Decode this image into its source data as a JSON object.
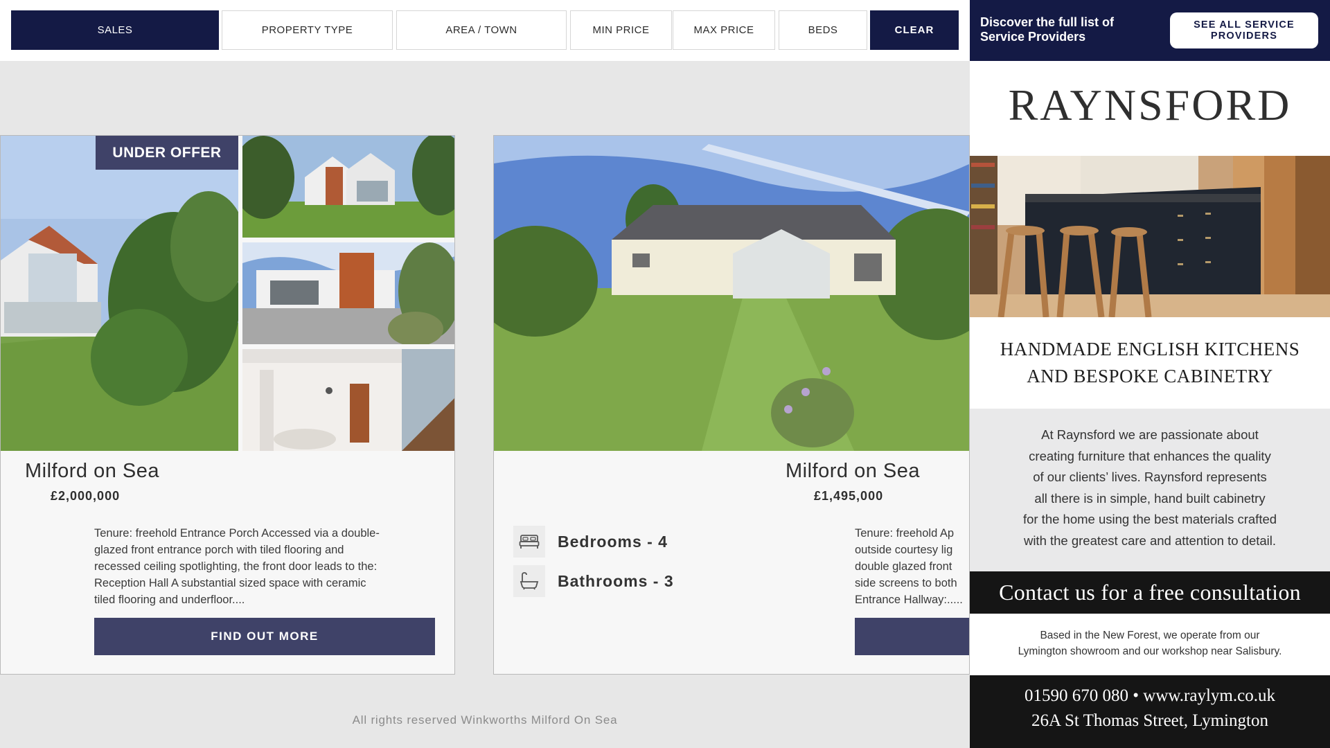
{
  "filters": {
    "sales": "SALES",
    "property_type": "PROPERTY TYPE",
    "area_town": "AREA / TOWN",
    "min_price": "MIN PRICE",
    "max_price": "MAX PRICE",
    "beds": "BEDS",
    "clear": "CLEAR"
  },
  "listings": [
    {
      "badge": "UNDER OFFER",
      "town": "Milford on Sea",
      "price": "£2,000,000",
      "description": "Tenure: freehold Entrance Porch Accessed via a double-\nglazed front entrance porch with tiled flooring and\nrecessed ceiling spotlighting, the front door leads to the:\nReception Hall A substantial sized space with ceramic\ntiled flooring and underfloor....",
      "cta": "FIND OUT MORE"
    },
    {
      "town": "Milford on Sea",
      "price": "£1,495,000",
      "bedrooms": "Bedrooms - 4",
      "bathrooms": "Bathrooms - 3",
      "description": "Tenure: freehold Ap\noutside courtesy lig\ndouble glazed front\nside screens to both\nEntrance Hallway:....."
    }
  ],
  "footer": "All rights reserved Winkworths Milford On Sea",
  "ad": {
    "discover": "Discover the full list of Service Providers",
    "see_all": "SEE ALL SERVICE PROVIDERS",
    "brand": "RAYNSFORD",
    "tagline": "HANDMADE ENGLISH KITCHENS\nAND BESPOKE CABINETRY",
    "about": "At Raynsford we are passionate about\ncreating furniture that enhances the quality\nof our clients’ lives. Raynsford represents\nall there is in simple, hand built cabinetry\nfor the home using the best materials crafted\nwith the greatest care and attention to detail.",
    "contact": "Contact us for a free consultation",
    "based": "Based in the New Forest, we operate from our\nLymington showroom and our workshop near Salisbury.",
    "phone_web": "01590 670 080 • www.raylym.co.uk",
    "address": "26A St Thomas Street, Lymington"
  },
  "colors": {
    "navy": "#141a45",
    "button_slate": "#3f4268",
    "page_grey": "#e7e7e7"
  },
  "icons": [
    "bed-icon",
    "bath-icon"
  ]
}
